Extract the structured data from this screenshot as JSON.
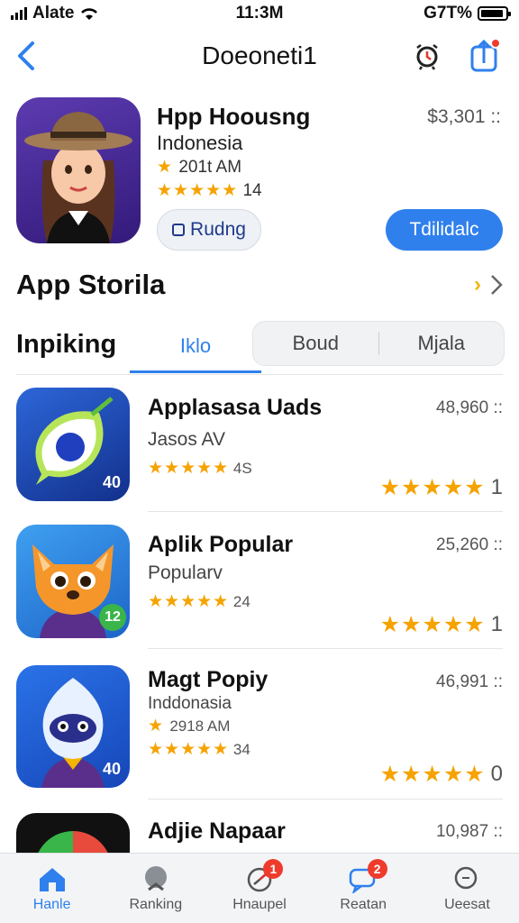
{
  "status_bar": {
    "carrier": "Alate",
    "time": "11:3M",
    "battery": "G7T%"
  },
  "nav": {
    "title": "Doeoneti1"
  },
  "featured": {
    "name": "Hpp Hoousng",
    "subtitle": "Indonesia",
    "meta": "201t AM",
    "rating_count": "14",
    "price": "$3,301 ::",
    "secondary_button": "Rudng",
    "primary_button": "Tdilidalc"
  },
  "section": {
    "heading": "App Storila",
    "more_accent": "›"
  },
  "tabs": {
    "label": "Inpiking",
    "items": [
      "Iklo",
      "Boud",
      "Mjala"
    ],
    "active_index": 0
  },
  "apps": [
    {
      "name": "Applasasa Uads",
      "subtitle": "Jasos AV",
      "rating_text": "4S",
      "downloads": "48,960 ::",
      "big_rating": "1",
      "badge": "40"
    },
    {
      "name": "Aplik Popular",
      "subtitle": "Popularv",
      "rating_text": "24",
      "downloads": "25,260 ::",
      "big_rating": "1",
      "badge": "12"
    },
    {
      "name": "Magt Popiy",
      "subtitle": "Inddonasia",
      "meta": "2918 AM",
      "rating_text": "34",
      "downloads": "46,991 ::",
      "big_rating": "0",
      "badge": "40"
    },
    {
      "name": "Adjie Napaar",
      "downloads": "10,987 ::"
    }
  ],
  "tabbar": {
    "items": [
      {
        "label": "Hanle",
        "icon": "home-icon",
        "active": true
      },
      {
        "label": "Ranking",
        "icon": "ranking-icon"
      },
      {
        "label": "Hnaupel",
        "icon": "clock-icon",
        "count": "1"
      },
      {
        "label": "Reatan",
        "icon": "chat-icon",
        "count": "2"
      },
      {
        "label": "Ueesat",
        "icon": "search-icon"
      }
    ]
  },
  "colors": {
    "accent": "#2f80ed",
    "star": "#f5a300",
    "badge": "#ef3b2c"
  }
}
